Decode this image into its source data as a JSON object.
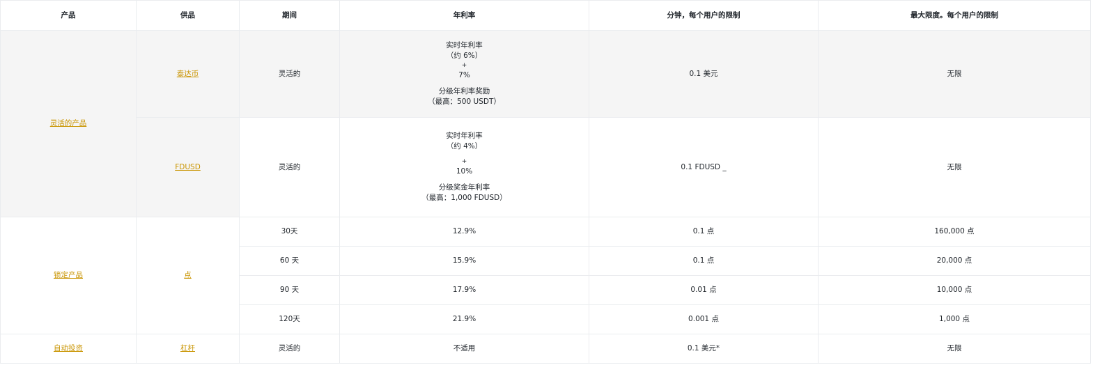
{
  "headers": {
    "product": "产品",
    "offering": "供品",
    "period": "期间",
    "apr": "年利率",
    "min_limit": "分钟，每个用户的限制",
    "max_limit": "最大限度。每个用户的限制"
  },
  "flexible": {
    "product": "灵活的产品",
    "rows": [
      {
        "offering": "泰达币",
        "period": "灵活的",
        "apr_realtime": "实时年利率",
        "apr_approx": "（约 6%）",
        "apr_plus": "+",
        "apr_bonus": "7%",
        "apr_tier": "分级年利率奖励",
        "apr_tier_cap": "（最高：500 USDT）",
        "min": "0.1 美元",
        "max": "无限"
      },
      {
        "offering": "FDUSD",
        "period": "灵活的",
        "apr_realtime": "实时年利率",
        "apr_approx": "（约 4%）",
        "apr_plus": "+",
        "apr_bonus": "10%",
        "apr_tier": "分级奖金年利率",
        "apr_tier_cap": "（最高：1,000 FDUSD）",
        "min": "0.1 FDUSD _",
        "max": "无限"
      }
    ]
  },
  "locked": {
    "product": "锁定产品",
    "offering": "点",
    "rows": [
      {
        "period": "30天",
        "apr": "12.9%",
        "min": "0.1 点",
        "max": "160,000 点"
      },
      {
        "period": "60 天",
        "apr": "15.9%",
        "min": "0.1 点",
        "max": "20,000 点"
      },
      {
        "period": "90 天",
        "apr": "17.9%",
        "min": "0.01 点",
        "max": "10,000 点"
      },
      {
        "period": "120天",
        "apr": "21.9%",
        "min": "0.001 点",
        "max": "1,000 点"
      }
    ]
  },
  "auto_invest": {
    "product": "自动投资",
    "offering": "杠杆",
    "period": "灵活的",
    "apr": "不适用",
    "min": "0.1 美元*",
    "max": "无限"
  },
  "colors": {
    "link": "#c99400",
    "shade": "#f5f5f5",
    "border": "#eaecef",
    "text": "#1e2329"
  }
}
